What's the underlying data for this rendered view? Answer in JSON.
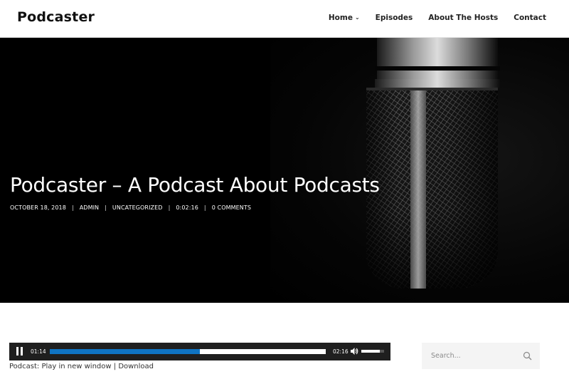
{
  "site": {
    "logo": "Podcaster"
  },
  "nav": {
    "items": [
      {
        "label": "Home",
        "has_dropdown": true
      },
      {
        "label": "Episodes"
      },
      {
        "label": "About The Hosts"
      },
      {
        "label": "Contact"
      }
    ],
    "dropdown_glyph": "⌄"
  },
  "hero": {
    "title": "Podcaster – A Podcast About Podcasts",
    "meta": {
      "date": "OCTOBER 18, 2018",
      "author": "ADMIN",
      "category": "UNCATEGORIZED",
      "duration": "0:02:16",
      "comments": "0 COMMENTS",
      "separator": "|"
    }
  },
  "player": {
    "current_time": "01:14",
    "total_time": "02:16",
    "progress_fraction": 0.544,
    "volume_fraction": 0.8,
    "accent_color": "#0f74c3",
    "play_state_icon": "pause-icon",
    "volume_icon": "volume-icon"
  },
  "podcast_links": {
    "prefix": "Podcast: ",
    "play_new_window": "Play in new window",
    "separator": " | ",
    "download": "Download"
  },
  "search": {
    "placeholder": "Search...",
    "icon": "search-icon"
  }
}
